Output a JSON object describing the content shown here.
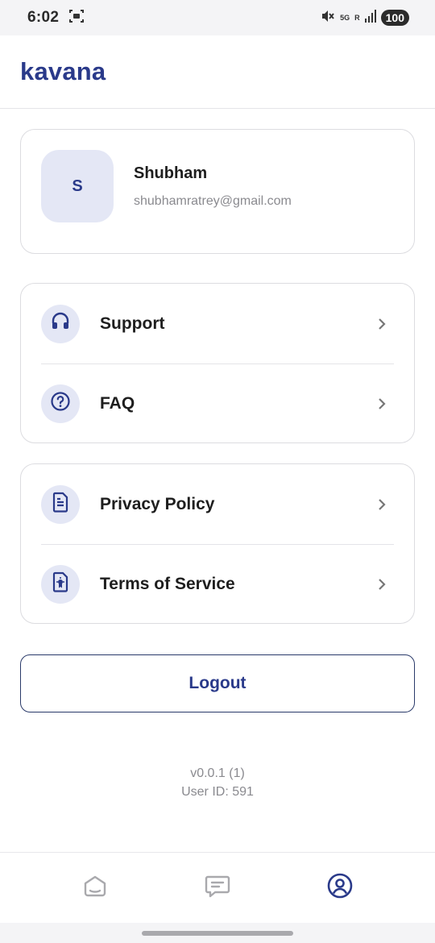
{
  "status_bar": {
    "time": "6:02",
    "network": "5G",
    "signal_label": "R",
    "battery": "100",
    "icons": [
      "screenshot-icon",
      "mute-icon",
      "signal-icon"
    ]
  },
  "header": {
    "brand": "kavana"
  },
  "profile": {
    "initial": "S",
    "name": "Shubham",
    "email": "shubhamratrey@gmail.com"
  },
  "menu_group_1": [
    {
      "label": "Support",
      "icon": "headset-icon"
    },
    {
      "label": "FAQ",
      "icon": "question-circle-icon"
    }
  ],
  "menu_group_2": [
    {
      "label": "Privacy Policy",
      "icon": "document-icon"
    },
    {
      "label": "Terms of Service",
      "icon": "certificate-icon"
    }
  ],
  "logout_label": "Logout",
  "footer": {
    "version": "v0.0.1 (1)",
    "user_id": "User ID: 591"
  },
  "bottom_nav": {
    "items": [
      {
        "icon": "home-icon",
        "active": false
      },
      {
        "icon": "chat-icon",
        "active": false
      },
      {
        "icon": "profile-icon",
        "active": true
      }
    ]
  },
  "colors": {
    "brand": "#2a3a8a",
    "icon_bg": "#e4e7f5",
    "inactive_icon": "#a9a9ad",
    "muted_text": "#8a8a8f"
  }
}
